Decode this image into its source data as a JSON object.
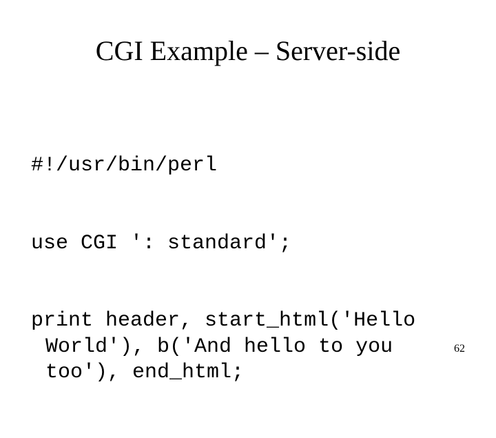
{
  "slide": {
    "title": "CGI Example – Server-side",
    "code": {
      "line1": "#!/usr/bin/perl",
      "line2": "use CGI ': standard';",
      "line3": "print header, start_html('Hello World'), b('And hello to you too'), end_html;"
    },
    "page_number": "62"
  }
}
